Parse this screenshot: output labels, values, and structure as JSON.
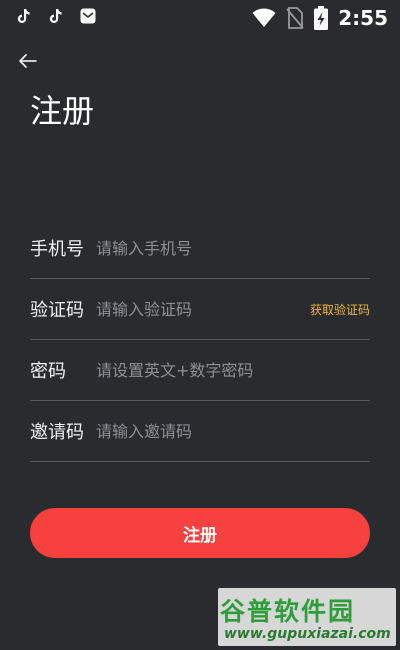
{
  "status_bar": {
    "time": "2:55",
    "left_icons": [
      "tiktok-icon",
      "tiktok-icon",
      "mail-app-icon"
    ],
    "right_icons": [
      "wifi-icon",
      "no-sim-icon",
      "battery-charging-icon"
    ]
  },
  "header": {
    "back_icon": "arrow-left-icon",
    "title": "注册"
  },
  "form": {
    "phone": {
      "label": "手机号",
      "placeholder": "请输入手机号"
    },
    "code": {
      "label": "验证码",
      "placeholder": "请输入验证码",
      "action": "获取验证码"
    },
    "password": {
      "label": "密码",
      "placeholder": "请设置英文+数字密码"
    },
    "invite": {
      "label": "邀请码",
      "placeholder": "请输入邀请码"
    }
  },
  "submit": {
    "label": "注册"
  },
  "watermark": {
    "brand": "谷普软件园",
    "url": "www.gupuxiazai.com"
  },
  "colors": {
    "background": "#2a2b2f",
    "accent": "#f7413e",
    "link": "#f0b43c",
    "divider": "#5a5b60"
  }
}
